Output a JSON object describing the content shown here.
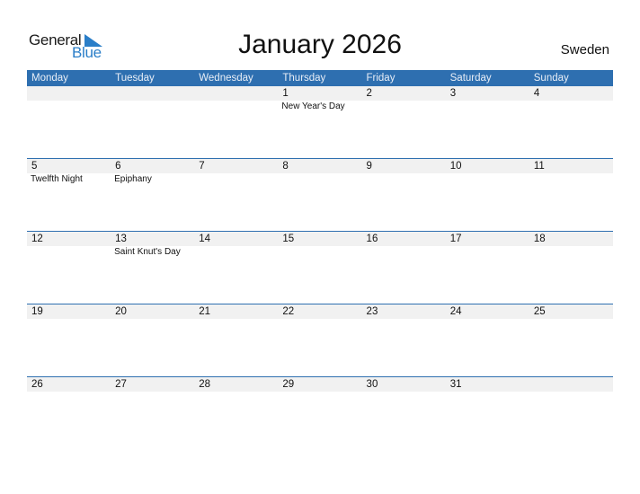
{
  "logo": {
    "general": "General",
    "blue": "Blue",
    "brand_color": "#2a7ec8"
  },
  "title": "January 2026",
  "country": "Sweden",
  "colors": {
    "header_bg": "#2e6fb0",
    "date_strip": "#f1f1f1"
  },
  "weekdays": [
    "Monday",
    "Tuesday",
    "Wednesday",
    "Thursday",
    "Friday",
    "Saturday",
    "Sunday"
  ],
  "weeks": [
    [
      {
        "day": "",
        "holiday": ""
      },
      {
        "day": "",
        "holiday": ""
      },
      {
        "day": "",
        "holiday": ""
      },
      {
        "day": "1",
        "holiday": "New Year's Day"
      },
      {
        "day": "2",
        "holiday": ""
      },
      {
        "day": "3",
        "holiday": ""
      },
      {
        "day": "4",
        "holiday": ""
      }
    ],
    [
      {
        "day": "5",
        "holiday": "Twelfth Night"
      },
      {
        "day": "6",
        "holiday": "Epiphany"
      },
      {
        "day": "7",
        "holiday": ""
      },
      {
        "day": "8",
        "holiday": ""
      },
      {
        "day": "9",
        "holiday": ""
      },
      {
        "day": "10",
        "holiday": ""
      },
      {
        "day": "11",
        "holiday": ""
      }
    ],
    [
      {
        "day": "12",
        "holiday": ""
      },
      {
        "day": "13",
        "holiday": "Saint Knut's Day"
      },
      {
        "day": "14",
        "holiday": ""
      },
      {
        "day": "15",
        "holiday": ""
      },
      {
        "day": "16",
        "holiday": ""
      },
      {
        "day": "17",
        "holiday": ""
      },
      {
        "day": "18",
        "holiday": ""
      }
    ],
    [
      {
        "day": "19",
        "holiday": ""
      },
      {
        "day": "20",
        "holiday": ""
      },
      {
        "day": "21",
        "holiday": ""
      },
      {
        "day": "22",
        "holiday": ""
      },
      {
        "day": "23",
        "holiday": ""
      },
      {
        "day": "24",
        "holiday": ""
      },
      {
        "day": "25",
        "holiday": ""
      }
    ],
    [
      {
        "day": "26",
        "holiday": ""
      },
      {
        "day": "27",
        "holiday": ""
      },
      {
        "day": "28",
        "holiday": ""
      },
      {
        "day": "29",
        "holiday": ""
      },
      {
        "day": "30",
        "holiday": ""
      },
      {
        "day": "31",
        "holiday": ""
      },
      {
        "day": "",
        "holiday": ""
      }
    ]
  ]
}
